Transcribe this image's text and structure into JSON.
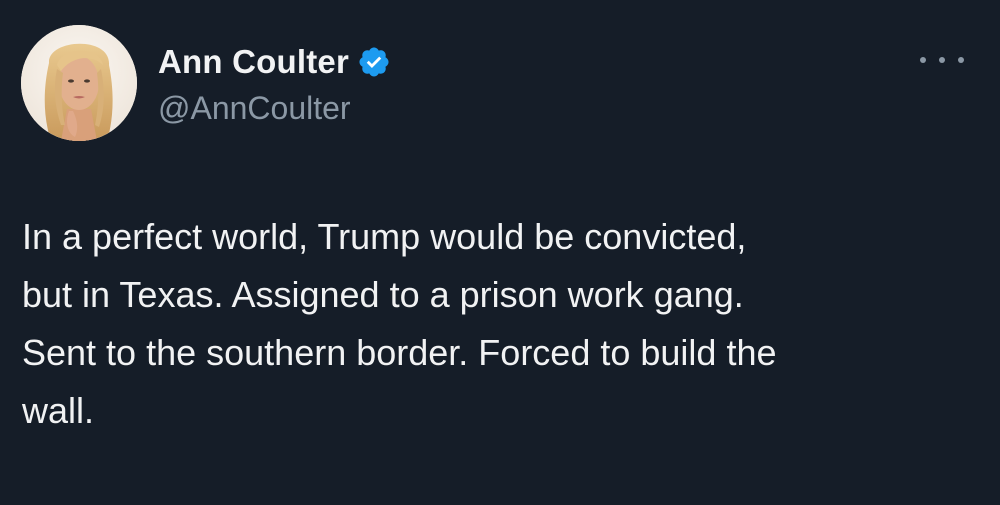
{
  "author": {
    "display_name": "Ann Coulter",
    "handle": "@AnnCoulter",
    "verified_icon": "verified-badge-icon",
    "avatar_icon": "profile-photo"
  },
  "more_menu_icon": "more-options-icon",
  "tweet": {
    "text": "In a perfect world, Trump would be convicted,\nbut in Texas. Assigned to a prison work gang.\nSent to the southern border. Forced to build the\nwall."
  },
  "colors": {
    "background": "#151d28",
    "text": "#f1f2f3",
    "secondary_text": "#8b98a5",
    "verified_blue": "#1d9bf0"
  }
}
